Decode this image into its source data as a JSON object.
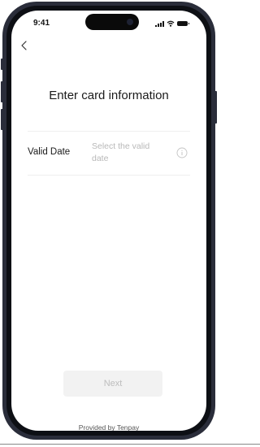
{
  "status_bar": {
    "time": "9:41"
  },
  "header": {
    "title": "Enter card information"
  },
  "form": {
    "valid_date": {
      "label": "Valid Date",
      "placeholder": "Select the valid date"
    }
  },
  "actions": {
    "next_label": "Next"
  },
  "footer": {
    "provider_text": "Provided by Tenpay"
  },
  "icons": {
    "back": "chevron-left-icon",
    "info": "info-icon",
    "signal": "signal-icon",
    "wifi": "wifi-icon",
    "battery": "battery-icon"
  },
  "colors": {
    "title_text": "#1a1a1a",
    "placeholder_text": "#b8b8b8",
    "disabled_button_bg": "#f2f2f2",
    "disabled_button_text": "#bdbdbd",
    "phone_frame": "#2a2d3a"
  }
}
